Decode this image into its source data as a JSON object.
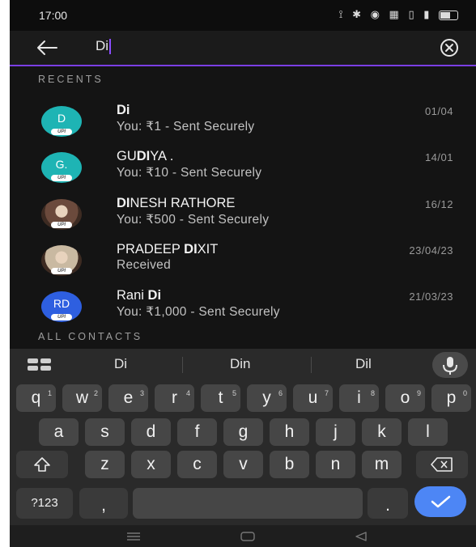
{
  "status_bar": {
    "time": "17:00",
    "icons": "⟟ ✱ ◉ ▦ ▯ ▮"
  },
  "search": {
    "query": "Di"
  },
  "sections": {
    "recents_label": "RECENTS",
    "contacts_label": "ALL CONTACTS"
  },
  "recents": [
    {
      "avatar_text": "D",
      "avatar_color": "#1eb4b4",
      "name_bold": "Di",
      "name_rest": "",
      "name_pre": "",
      "subtitle": "You: ₹1 - Sent Securely",
      "date": "01/04"
    },
    {
      "avatar_text": "G.",
      "avatar_color": "#1eb4b4",
      "name_pre": "GU",
      "name_bold": "DI",
      "name_rest": "YA  .",
      "subtitle": "You: ₹10 - Sent Securely",
      "date": "14/01"
    },
    {
      "avatar_text": "",
      "avatar_color": "#6b4a3c",
      "name_pre": "",
      "name_bold": "DI",
      "name_rest": "NESH RATHORE",
      "subtitle": "You: ₹500 - Sent Securely",
      "date": "16/12"
    },
    {
      "avatar_text": "",
      "avatar_color": "#c9b9a1",
      "name_pre": "PRADEEP ",
      "name_bold": "DI",
      "name_rest": "XIT",
      "subtitle": "Received",
      "date": "23/04/23"
    },
    {
      "avatar_text": "RD",
      "avatar_color": "#2e5fe0",
      "name_pre": "Rani ",
      "name_bold": "Di",
      "name_rest": "",
      "subtitle": "You: ₹1,000 - Sent Securely",
      "date": "21/03/23"
    }
  ],
  "badge": "UPI",
  "keyboard": {
    "suggestions": [
      "Di",
      "Din",
      "Dil"
    ],
    "row1": [
      {
        "k": "q",
        "h": "1"
      },
      {
        "k": "w",
        "h": "2"
      },
      {
        "k": "e",
        "h": "3"
      },
      {
        "k": "r",
        "h": "4"
      },
      {
        "k": "t",
        "h": "5"
      },
      {
        "k": "y",
        "h": "6"
      },
      {
        "k": "u",
        "h": "7"
      },
      {
        "k": "i",
        "h": "8"
      },
      {
        "k": "o",
        "h": "9"
      },
      {
        "k": "p",
        "h": "0"
      }
    ],
    "row2": [
      "a",
      "s",
      "d",
      "f",
      "g",
      "h",
      "j",
      "k",
      "l"
    ],
    "row3": [
      "z",
      "x",
      "c",
      "v",
      "b",
      "n",
      "m"
    ],
    "symbols_label": "?123",
    "comma": ",",
    "period": "."
  },
  "colors": {
    "accent": "#7b3fe4",
    "enter": "#4d86f5"
  }
}
